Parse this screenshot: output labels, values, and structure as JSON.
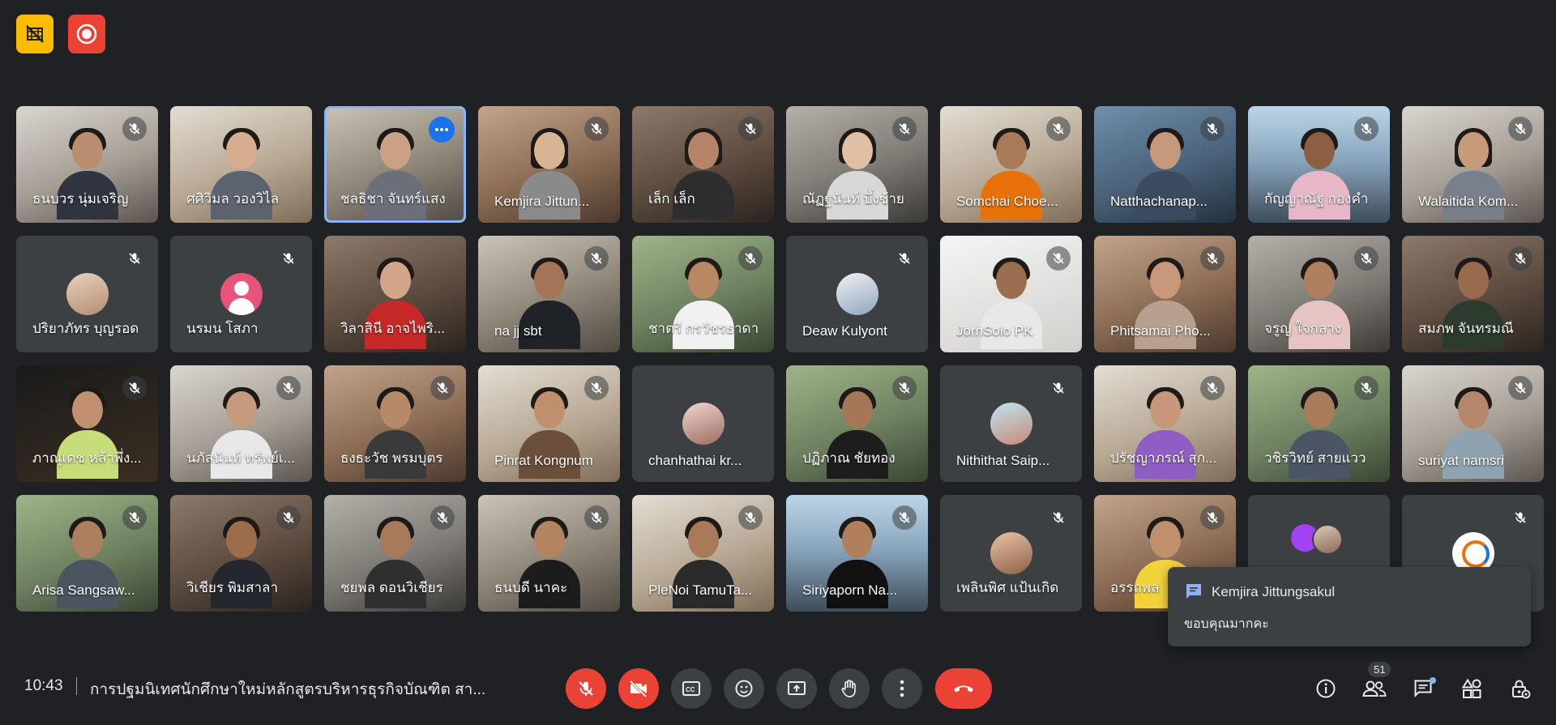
{
  "colors": {
    "background": "#202124",
    "tile": "#3c4043",
    "red": "#ea4335",
    "yellow": "#fbbc04",
    "accent_blue": "#8ab4f8"
  },
  "top_badges": [
    {
      "name": "recording-indicator",
      "icon": "film-off-icon"
    },
    {
      "name": "recording-dot",
      "icon": "record-icon"
    }
  ],
  "participants": [
    "ธนบวร นุ่มเจริญ",
    "ศศิวิมล วองวิไล",
    "ชลธิชา จันทร์แสง",
    "Kemjira Jittun...",
    "เล็ก เล็ก",
    "ณัฏฐนันท์ บึ้งซ้าย",
    "Somchai Choe...",
    "Natthachanap...",
    "กัญญาณัฐ กองคำ",
    "Walaitida Kom...",
    "ปริยาภัทร บุญรอด",
    "นรมน โสภา",
    "วิลาสินี อาจไพริ...",
    "na jj sbt",
    "ชาตรี กรวัชรธาดา",
    "Deaw Kulyont",
    "JornSolo PK",
    "Phitsamai Pho...",
    "จรูญ ใจกลาง",
    "สมภพ จันทรมณี",
    "ภาณุเดช หล้าพึ่ง...",
    "นภัสนันท์ ทรัพย์เ...",
    "ธงธะวัช พรมบุตร",
    "Pinrat Kongnum",
    "chanhathai kr...",
    "ปฏิภาณ ชัยทอง",
    "Nithithat Saip...",
    "ปรัชญาภรณ์ สุก...",
    "วชิรวิทย์ สายแวว",
    "suriyat namsri",
    "Arisa Sangsaw...",
    "วิเชียร พิมสาลา",
    "ชยพล ดอนวิเชียร",
    "ธนบดี นาคะ",
    "PleNoi TamuTa...",
    "Siriyaporn Na...",
    "เพลินพิศ แป้นเกิด",
    "อรรถพล",
    "",
    ""
  ],
  "chat_toast": {
    "sender": "Kemjira Jittungsakul",
    "message": "ขอบคุณมากคะ"
  },
  "bottom_bar": {
    "time": "10:43",
    "meeting_title": "การปฐมนิเทศนักศึกษาใหม่หลักสูตรบริหารธุรกิจบัณฑิต สา...",
    "participant_count": "51"
  },
  "controls": [
    "mic-off-icon",
    "camera-off-icon",
    "captions-icon",
    "emoji-icon",
    "present-icon",
    "raise-hand-icon",
    "more-options-icon",
    "end-call-icon"
  ],
  "right_controls": [
    "info-icon",
    "people-icon",
    "chat-icon",
    "activities-icon",
    "host-controls-icon"
  ]
}
